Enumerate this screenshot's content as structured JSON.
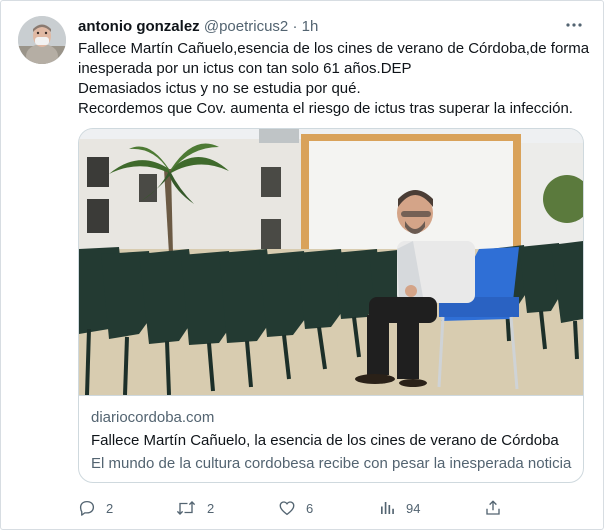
{
  "tweet": {
    "author_name": "antonio gonzalez",
    "handle": "@poetricus2",
    "separator": "·",
    "time": "1h",
    "lines": [
      "Fallece Martín Cañuelo,esencia de los cines de verano de Córdoba,de forma",
      "inesperada por un ictus con tan solo 61 años.DEP",
      "Demasiados ictus y no se estudia por qué.",
      "Recordemos que Cov. aumenta el riesgo de ictus tras superar la infección."
    ]
  },
  "card": {
    "domain": "diariocordoba.com",
    "title": "Fallece Martín Cañuelo, la esencia de los cines de verano de Córdoba",
    "description": "El mundo de la cultura cordobesa recibe con pesar la inesperada noticia"
  },
  "actions": {
    "replies": "2",
    "retweets": "2",
    "likes": "6",
    "views": "94"
  },
  "colors": {
    "text_primary": "#0f1419",
    "text_secondary": "#536471",
    "border": "#cfd9de"
  }
}
